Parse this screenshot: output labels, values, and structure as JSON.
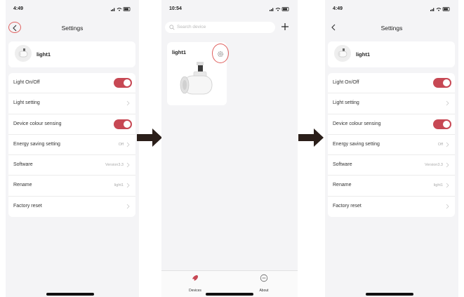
{
  "panels": [
    {
      "status_time": "4:49",
      "title": "Settings",
      "device_name": "light1",
      "rows": [
        {
          "label": "Light On/Off",
          "type": "toggle",
          "on": true
        },
        {
          "label": "Light setting",
          "type": "chevron",
          "value": ""
        },
        {
          "label": "Device colour sensing",
          "type": "toggle",
          "on": true
        },
        {
          "label": "Energy saving setting",
          "type": "chevron",
          "value": "Off"
        },
        {
          "label": "Software",
          "type": "chevron",
          "value": "Version3.3"
        },
        {
          "label": "Rename",
          "type": "chevron",
          "value": "light1"
        },
        {
          "label": "Factory reset",
          "type": "chevron",
          "value": ""
        }
      ]
    },
    {
      "status_time": "10:54",
      "search_placeholder": "Search device",
      "device_tile_name": "light1",
      "tabs": [
        {
          "label": "Devices",
          "icon": "devices-icon"
        },
        {
          "label": "About",
          "icon": "about-icon"
        }
      ]
    },
    {
      "status_time": "4:49",
      "title": "Settings",
      "device_name": "light1",
      "rows": [
        {
          "label": "Light On/Off",
          "type": "toggle",
          "on": true
        },
        {
          "label": "Light setting",
          "type": "chevron",
          "value": ""
        },
        {
          "label": "Device colour sensing",
          "type": "toggle",
          "on": true
        },
        {
          "label": "Energy saving setting",
          "type": "chevron",
          "value": "Off"
        },
        {
          "label": "Software",
          "type": "chevron",
          "value": "Version3.3"
        },
        {
          "label": "Rename",
          "type": "chevron",
          "value": "light1"
        },
        {
          "label": "Factory reset",
          "type": "chevron",
          "value": ""
        }
      ]
    }
  ],
  "colors": {
    "accent": "#c74854",
    "highlight": "#e0605e",
    "background": "#f4f4f6"
  }
}
